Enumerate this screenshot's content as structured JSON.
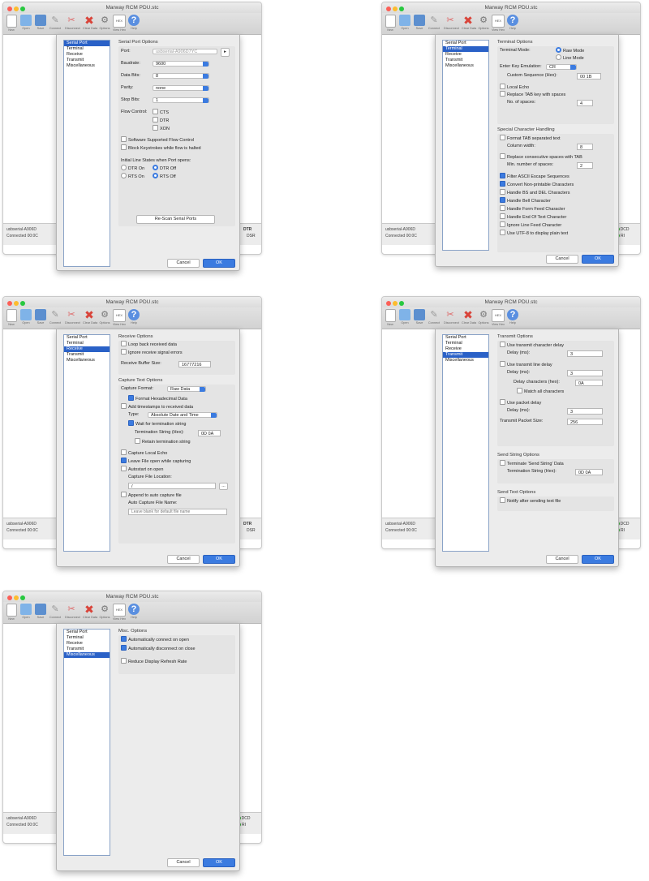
{
  "app": {
    "title": "Marway RCM PDU.stc",
    "toolbar": [
      {
        "label": "New",
        "icon": "new-file-icon"
      },
      {
        "label": "Open",
        "icon": "open-folder-icon"
      },
      {
        "label": "Save",
        "icon": "save-disk-icon"
      },
      {
        "label": "Connect",
        "icon": "connect-plug-icon"
      },
      {
        "label": "Disconnect",
        "icon": "disconnect-plug-icon"
      },
      {
        "label": "Clear Data",
        "icon": "clear-x-icon"
      },
      {
        "label": "Options",
        "icon": "options-gear-icon"
      },
      {
        "label": "View Hex",
        "icon": "hex-icon"
      },
      {
        "label": "Help",
        "icon": "help-icon"
      }
    ],
    "status": {
      "port": "usbserial-A906D",
      "connection": "Connected 00:0C",
      "signals": [
        "DTR",
        "DCD",
        "DSR",
        "RI"
      ]
    },
    "colors": {
      "accent": "#3b7be0",
      "signal_on": "#3da83d",
      "close": "#fc5f57",
      "minimize": "#fdbc2e",
      "zoom": "#28c840"
    }
  },
  "categories": [
    "Serial Port",
    "Terminal",
    "Receive",
    "Transmit",
    "Miscellaneous"
  ],
  "buttons": {
    "cancel": "Cancel",
    "ok": "OK"
  },
  "serial": {
    "title": "Serial Port Options",
    "port_label": "Port:",
    "port_value": "usbserial-A906D7YC",
    "baud_label": "Baudrate:",
    "baud_value": "9600",
    "databits_label": "Data Bits:",
    "databits_value": "8",
    "parity_label": "Parity:",
    "parity_value": "none",
    "stopbits_label": "Stop Bits:",
    "stopbits_value": "1",
    "flow_label": "Flow Control:",
    "flow": [
      "CTS",
      "DTR",
      "XON"
    ],
    "software_flow": "Software Supported Flow Control",
    "block": "Block Keystrokes while flow is halted",
    "initial_title": "Initial Line States when Port opens:",
    "dtr_on": "DTR On",
    "dtr_off": "DTR Off",
    "rts_on": "RTS On",
    "rts_off": "RTS Off",
    "rescan": "Re-Scan Serial Ports"
  },
  "terminal": {
    "title": "Terminal Options",
    "mode_label": "Terminal Mode:",
    "raw": "Raw Mode",
    "line": "Line Mode",
    "emul_label": "Enter Key Emulation:",
    "emul_value": "CR",
    "custom_label": "Custom Sequence (Hex):",
    "custom_value": "00 1B",
    "local_echo": "Local Echo",
    "replace_tab": "Replace TAB key with spaces",
    "spaces_label": "No. of spaces:",
    "spaces_value": "4",
    "special_title": "Special Character Handling",
    "format_tab": "Format TAB separated text",
    "colwidth_label": "Column width:",
    "colwidth_value": "8",
    "replace_spaces": "Replace consecutive spaces with TAB",
    "minspaces_label": "Min. number of spaces:",
    "minspaces_value": "2",
    "handling": [
      {
        "label": "Filter ASCII Escape Sequences",
        "on": true
      },
      {
        "label": "Convert Non-printable Characters",
        "on": true
      },
      {
        "label": "Handle BS and DEL Characters",
        "on": false
      },
      {
        "label": "Handle Bell Character",
        "on": true
      },
      {
        "label": "Handle Form Feed Character",
        "on": false
      },
      {
        "label": "Handle End Of Text Character",
        "on": false
      },
      {
        "label": "Ignore Line Feed Character",
        "on": false
      },
      {
        "label": "Use UTF-8 to display plain text",
        "on": false
      }
    ]
  },
  "receive": {
    "title": "Receive Options",
    "loop": "Loop back received data",
    "ignore": "Ignore receive signal errors",
    "buffer_label": "Receive Buffer Size:",
    "buffer_value": "16777216",
    "capture_title": "Capture Text Options",
    "format_label": "Capture Format:",
    "format_value": "Raw Data",
    "format_hex": "Format Hexadecimal Data",
    "timestamps": "Add timestamps to received data",
    "type_label": "Type:",
    "type_value": "Absolute Date and Time",
    "wait": "Wait for termination string",
    "term_label": "Termination String (Hex):",
    "term_value": "0D 0A",
    "retain": "Retain termination string",
    "capture_echo": "Capture Local Echo",
    "leave_open": "Leave File open while capturing",
    "autostart": "Autostart on open",
    "location_label": "Capture File Location:",
    "location_value": "/",
    "browse": "...",
    "append": "Append to auto capture file",
    "auto_name_label": "Auto Capture File Name:",
    "auto_name_placeholder": "Leave blank for default file name"
  },
  "transmit": {
    "title": "Transmit Options",
    "char_delay": "Use transmit character delay",
    "delay_label": "Delay (ms):",
    "char_delay_value": "3",
    "line_delay": "Use transmit line delay",
    "line_delay_value": "3",
    "delay_chars_label": "Delay characters (hex):",
    "delay_chars_value": "0A",
    "match_all": "Match all characters",
    "packet_delay": "Use packet delay",
    "packet_delay_value": "3",
    "packet_size_label": "Transmit Packet Size:",
    "packet_size_value": "256",
    "send_string_title": "Send String Options",
    "terminate": "Terminate 'Send String' Data",
    "term_label": "Termination String (Hex):",
    "term_value": "0D 0A",
    "send_text_title": "Send Text Options",
    "notify": "Notify after sending text file"
  },
  "misc": {
    "title": "Misc. Options",
    "items": [
      {
        "label": "Automatically connect on open",
        "on": true
      },
      {
        "label": "Automatically disconnect on close",
        "on": true
      },
      {
        "label": "Reduce Display Refresh Rate",
        "on": false
      }
    ]
  }
}
